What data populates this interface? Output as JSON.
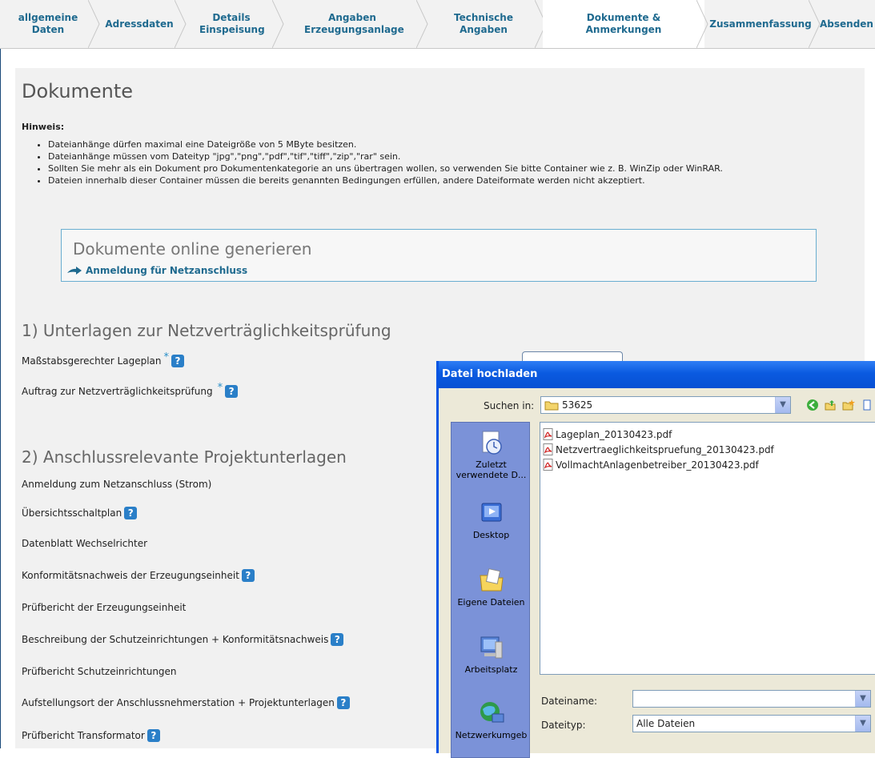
{
  "wizard": {
    "steps": [
      {
        "label": "allgemeine Daten"
      },
      {
        "label": "Adressdaten"
      },
      {
        "label": "Details Einspeisung"
      },
      {
        "label": "Angaben Erzeugungsanlage"
      },
      {
        "label": "Technische Angaben"
      },
      {
        "label": "Dokumente & Anmerkungen"
      },
      {
        "label": "Zusammenfassung"
      },
      {
        "label": "Absenden"
      }
    ]
  },
  "page": {
    "title": "Dokumente",
    "hinweis_label": "Hinweis:",
    "rules": [
      "Dateianhänge dürfen maximal eine Dateigröße von 5 MByte besitzen.",
      "Dateianhänge müssen vom Dateityp \"jpg\",\"png\",\"pdf\",\"tif\",\"tiff\",\"zip\",\"rar\" sein.",
      "Sollten Sie mehr als ein Dokument pro Dokumentenkategorie an uns übertragen wollen, so verwenden Sie bitte Container wie z. B. WinZip oder WinRAR.",
      "Dateien innerhalb dieser Container müssen die bereits genannten Bedingungen erfüllen, andere Dateiformate werden nicht akzeptiert."
    ],
    "online_box": {
      "title": "Dokumente online generieren",
      "link": "Anmeldung für Netzanschluss"
    },
    "section1": {
      "title": "1) Unterlagen zur Netzverträglichkeitsprüfung",
      "items": [
        {
          "label": "Maßstabsgerechter Lageplan",
          "required": "*",
          "help": "?"
        },
        {
          "label": "Auftrag zur Netzverträglichkeitsprüfung",
          "required": "*",
          "help": "?"
        }
      ]
    },
    "section2": {
      "title": "2) Anschlussrelevante Projektunterlagen",
      "items": [
        {
          "label": "Anmeldung zum Netzanschluss (Strom)"
        },
        {
          "label": "Übersichtsschaltplan",
          "help": "?"
        },
        {
          "label": "Datenblatt Wechselrichter"
        },
        {
          "label": "Konformitätsnachweis der Erzeugungseinheit",
          "help": "?"
        },
        {
          "label": "Prüfbericht der Erzeugungseinheit"
        },
        {
          "label": "Beschreibung der Schutzeinrichtungen + Konformitätsnachweis",
          "help": "?"
        },
        {
          "label": "Prüfbericht Schutzeinrichtungen"
        },
        {
          "label": "Aufstellungsort der Anschlussnehmerstation + Projektunterlagen",
          "help": "?"
        },
        {
          "label": "Prüfbericht Transformator",
          "help": "?"
        }
      ]
    }
  },
  "dialog": {
    "title": "Datei hochladen",
    "lookin_label": "Suchen in:",
    "lookin_value": "53625",
    "places": [
      {
        "label": "Zuletzt verwendete D...",
        "icon": "recent-icon"
      },
      {
        "label": "Desktop",
        "icon": "desktop-icon"
      },
      {
        "label": "Eigene Dateien",
        "icon": "my-documents-icon"
      },
      {
        "label": "Arbeitsplatz",
        "icon": "my-computer-icon"
      },
      {
        "label": "Netzwerkumgeb",
        "icon": "network-icon"
      }
    ],
    "files": [
      "Lageplan_20130423.pdf",
      "Netzvertraeglichkeitspruefung_20130423.pdf",
      "VollmachtAnlagenbetreiber_20130423.pdf"
    ],
    "filename_label": "Dateiname:",
    "filename_value": "",
    "filetype_label": "Dateityp:",
    "filetype_value": "Alle Dateien",
    "colors": {
      "title_bar": "#0a5ae0",
      "dialog_bg": "#ece9d8",
      "accent": "#1f6a8f"
    }
  }
}
